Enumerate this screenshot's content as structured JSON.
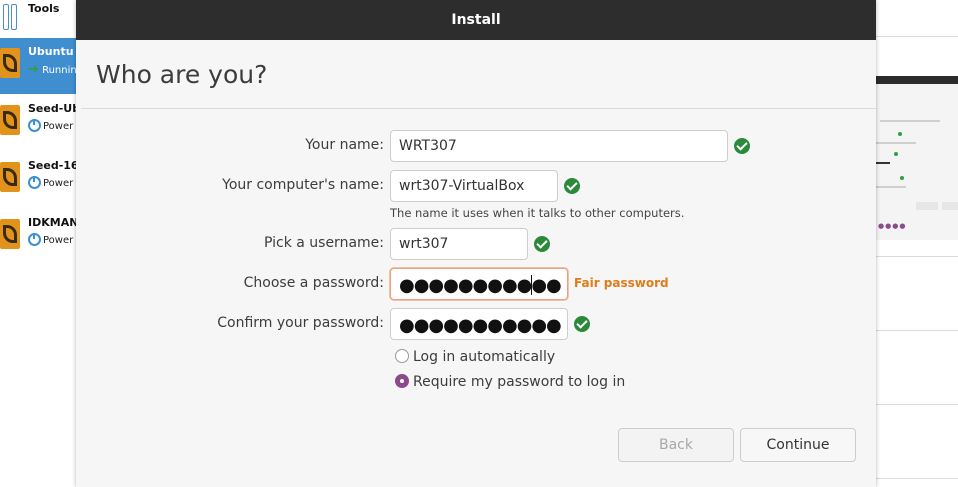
{
  "vbox": {
    "tools_label": "Tools",
    "vms": [
      {
        "name": "Ubuntu",
        "status": "Running",
        "status_icon": "running-arrow-icon"
      },
      {
        "name": "Seed-Ub",
        "status": "Power",
        "status_icon": "power-off-icon"
      },
      {
        "name": "Seed-16",
        "status": "Power",
        "status_icon": "power-off-icon"
      },
      {
        "name": "IDKMAN",
        "status": "Power",
        "status_icon": "power-off-icon"
      }
    ]
  },
  "dialog": {
    "title": "Install",
    "heading": "Who are you?",
    "fields": {
      "name_label": "Your name:",
      "name_value": "WRT307",
      "computer_label": "Your computer's name:",
      "computer_value": "wrt307-VirtualBox",
      "computer_hint": "The name it uses when it talks to other computers.",
      "username_label": "Pick a username:",
      "username_value": "wrt307",
      "password_label": "Choose a password:",
      "password_mask": "●●●●●●●●●●●",
      "password_strength": "Fair password",
      "confirm_label": "Confirm your password:",
      "confirm_mask": "●●●●●●●●●●●"
    },
    "login_options": {
      "auto_label": "Log in automatically",
      "require_label": "Require my password to log in",
      "selected": "require"
    },
    "buttons": {
      "back": "Back",
      "continue": "Continue"
    }
  },
  "colors": {
    "titlebar": "#2d2d2d",
    "selection": "#3e8ed0",
    "check": "#2a8a3a",
    "strength_fair": "#e07b1a",
    "radio_accent": "#8b4a8c"
  }
}
